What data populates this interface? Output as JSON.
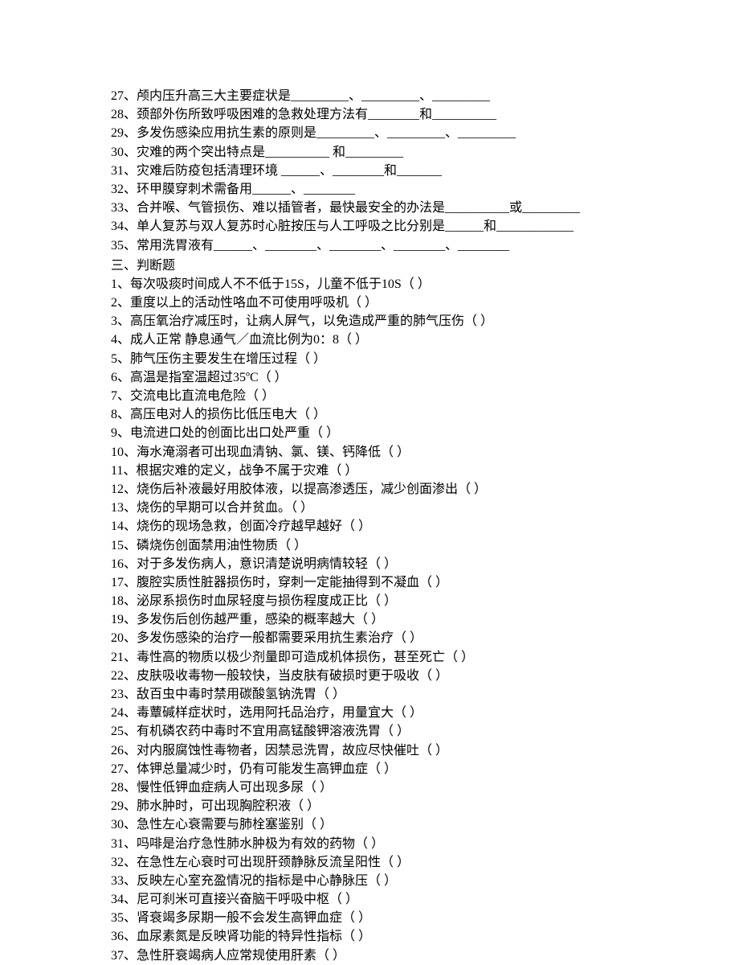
{
  "fillIn": {
    "q27": "27、颅内压升高三大主要症状是_________、_________、_________",
    "q28": "28、颈部外伤所致呼吸困难的急救处理方法有________和__________",
    "q29": "29、多发伤感染应用抗生素的原则是_________、_________、_________",
    "q30": "30、灾难的两个突出特点是__________  和_________",
    "q31": "31、灾难后防疫包括清理环境  ______、________和_______",
    "q32": "32、环甲膜穿刺术需备用______、________",
    "q33": "33、合并喉、气管损伤、难以插管者，最快最安全的办法是__________或_________",
    "q34": "34、单人复苏与双人复苏时心脏按压与人工呼吸之比分别是______和____________",
    "q35": "35、常用洗胃液有______、________、________、________、________"
  },
  "section3Title": "三、判断题",
  "judge": {
    "q1": "1、每次吸痰时间成人不不低于15S，儿童不低于10S（  ）",
    "q2": "2、重度以上的活动性咯血不可使用呼吸机（  ）",
    "q3": "3、高压氧治疗减压时，让病人屏气，以免造成严重的肺气压伤（  ）",
    "q4": "4、成人正常  静息通气／血流比例为0：8（  ）",
    "q5": "5、肺气压伤主要发生在增压过程（  ）",
    "q6": "6、高温是指室温超过35ºC（  ）",
    "q7": "7、交流电比直流电危险（  ）",
    "q8": "8、高压电对人的损伤比低压电大（  ）",
    "q9": "9、电流进口处的创面比出口处严重（  ）",
    "q10": "10、海水淹溺者可出现血清钠、氯、镁、钙降低（  ）",
    "q11": "11、根据灾难的定义，战争不属于灾难（  ）",
    "q12": "12、烧伤后补液最好用胶体液，以提高渗透压，减少创面渗出（  ）",
    "q13": "13、烧伤的早期可以合并贫血。（  ）",
    "q14": "14、烧伤的现场急救，创面冷疗越早越好（  ）",
    "q15": "15、磷烧伤创面禁用油性物质（  ）",
    "q16": "16、对于多发伤病人，意识清楚说明病情较轻（  ）",
    "q17": "17、腹腔实质性脏器损伤时，穿刺一定能抽得到不凝血（  ）",
    "q18": "18、泌尿系损伤时血尿轻度与损伤程度成正比（  ）",
    "q19": "19、多发伤后创伤越严重，感染的概率越大（  ）",
    "q20": "20、多发伤感染的治疗一般都需要采用抗生素治疗（  ）",
    "q21": "21、毒性高的物质以极少剂量即可造成机体损伤，甚至死亡（  ）",
    "q22": "22、皮肤吸收毒物一般较快，当皮肤有破损时更于吸收（  ）",
    "q23": "23、敌百虫中毒时禁用碳酸氢钠洗胃（  ）",
    "q24": "24、毒蕈碱样症状时，选用阿托品治疗，用量宜大（  ）",
    "q25": "25、有机磷农药中毒时不宜用高锰酸钾溶液洗胃（  ）",
    "q26": "26、对内服腐蚀性毒物者，因禁忌洗胃，故应尽快催吐（  ）",
    "q27": "27、体钾总量减少时，仍有可能发生高钾血症（  ）",
    "q28": "28、慢性低钾血症病人可出现多尿（  ）",
    "q29": "29、肺水肿时，可出现胸腔积液（  ）",
    "q30": "30、急性左心衰需要与肺栓塞鉴别（  ）",
    "q31": "31、吗啡是治疗急性肺水肿极为有效的药物（  ）",
    "q32": "32、在急性左心衰时可出现肝颈静脉反流呈阳性（  ）",
    "q33": "33、反映左心室充盈情况的指标是中心静脉压（  ）",
    "q34": "34、尼可刹米可直接兴奋脑干呼吸中枢（  ）",
    "q35": "35、肾衰竭多尿期一般不会发生高钾血症（  ）",
    "q36": "36、血尿素氮是反映肾功能的特异性指标（  ）",
    "q37": "37、急性肝衰竭病人应常规使用肝素（  ）"
  }
}
